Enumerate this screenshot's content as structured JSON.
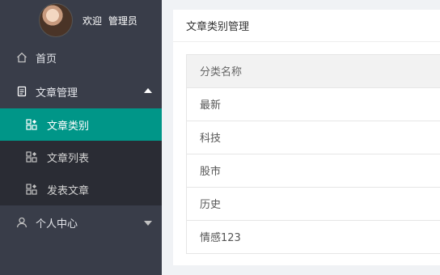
{
  "user": {
    "greeting": "欢迎",
    "name": "管理员"
  },
  "sidebar": {
    "items": [
      {
        "label": "首页",
        "icon": "home-icon"
      },
      {
        "label": "文章管理",
        "icon": "document-icon",
        "expanded": true,
        "children": [
          {
            "label": "文章类别",
            "icon": "grid-icon",
            "active": true
          },
          {
            "label": "文章列表",
            "icon": "grid-icon"
          },
          {
            "label": "发表文章",
            "icon": "grid-icon"
          }
        ]
      },
      {
        "label": "个人中心",
        "icon": "user-icon",
        "expanded": false
      }
    ]
  },
  "panel": {
    "title": "文章类别管理",
    "table": {
      "header": "分类名称",
      "rows": [
        "最新",
        "科技",
        "股市",
        "历史",
        "情感123"
      ]
    }
  },
  "colors": {
    "sidebar_bg": "#393d49",
    "submenu_bg": "#2a2c34",
    "accent": "#009688"
  }
}
